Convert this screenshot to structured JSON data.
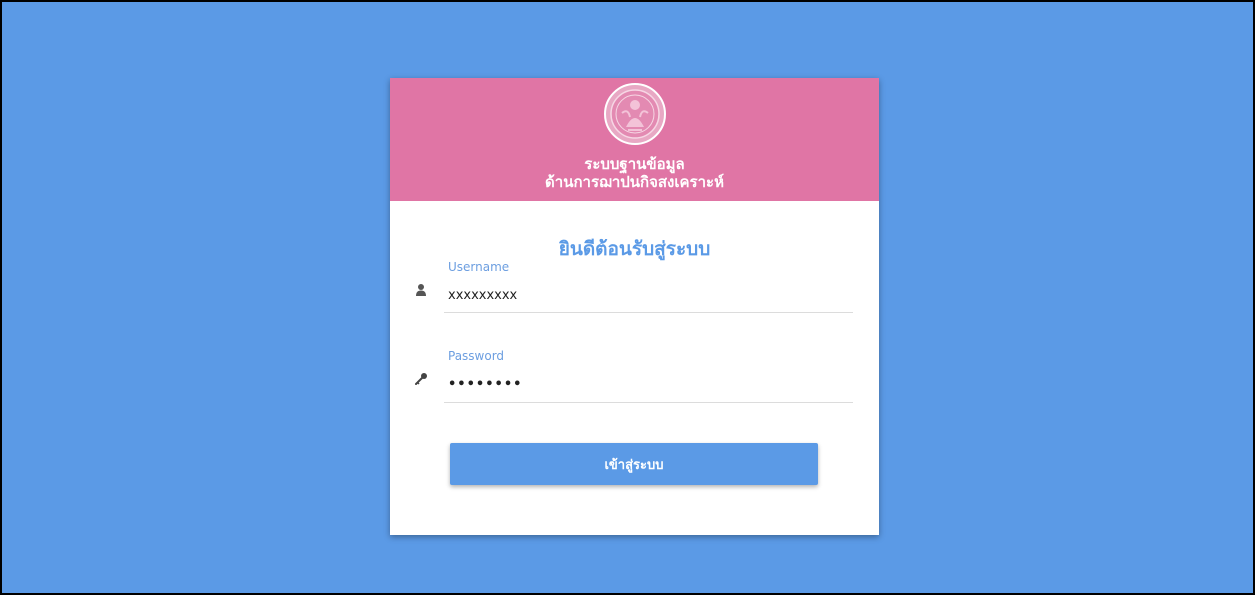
{
  "header": {
    "title_line1": "ระบบฐานข้อมูล",
    "title_line2": "ด้านการฌาปนกิจสงเคราะห์",
    "logo_icon": "government-seal-icon",
    "background_color": "#e075a5"
  },
  "login": {
    "welcome": "ยินดีต้อนรับสู่ระบบ",
    "username_label": "Username",
    "username_value": "xxxxxxxxx",
    "username_icon": "user-icon",
    "password_label": "Password",
    "password_value": "••••••••",
    "password_icon": "key-icon",
    "submit_label": "เข้าสู่ระบบ"
  },
  "colors": {
    "page_background": "#5b9ae6",
    "accent": "#5b9ae6",
    "header": "#e075a5"
  }
}
